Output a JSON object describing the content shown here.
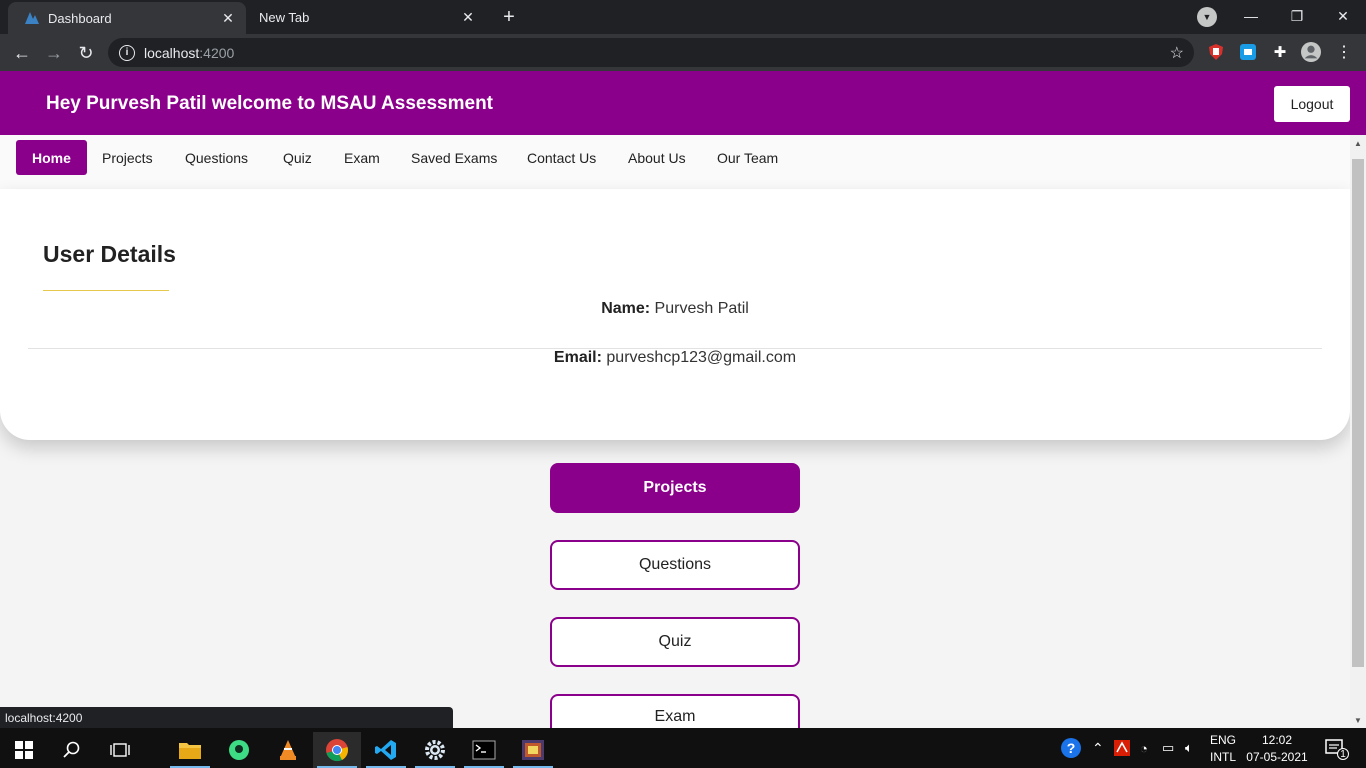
{
  "browser": {
    "tabs": [
      {
        "title": "Dashboard",
        "active": true
      },
      {
        "title": "New Tab",
        "active": false
      }
    ],
    "url_host": "localhost",
    "url_port": ":4200",
    "status_url": "localhost:4200"
  },
  "header": {
    "welcome": "Hey Purvesh Patil welcome to MSAU Assessment",
    "logout_label": "Logout"
  },
  "nav": {
    "items": [
      {
        "label": "Home",
        "active": true
      },
      {
        "label": "Projects"
      },
      {
        "label": "Questions"
      },
      {
        "label": "Quiz"
      },
      {
        "label": "Exam"
      },
      {
        "label": "Saved Exams"
      },
      {
        "label": "Contact Us"
      },
      {
        "label": "About Us"
      },
      {
        "label": "Our Team"
      }
    ]
  },
  "user_details": {
    "title": "User Details",
    "name_label": "Name:",
    "name_value": "Purvesh Patil",
    "email_label": "Email:",
    "email_value": "purveshcp123@gmail.com"
  },
  "actions": {
    "buttons": [
      {
        "label": "Projects",
        "style": "filled"
      },
      {
        "label": "Questions",
        "style": "outline"
      },
      {
        "label": "Quiz",
        "style": "outline"
      },
      {
        "label": "Exam",
        "style": "outline"
      }
    ]
  },
  "taskbar": {
    "lang_top": "ENG",
    "lang_bottom": "INTL",
    "time": "12:02",
    "date": "07-05-2021",
    "notification_count": "1"
  },
  "colors": {
    "accent": "#8b008b",
    "underline": "#e6c84a"
  }
}
